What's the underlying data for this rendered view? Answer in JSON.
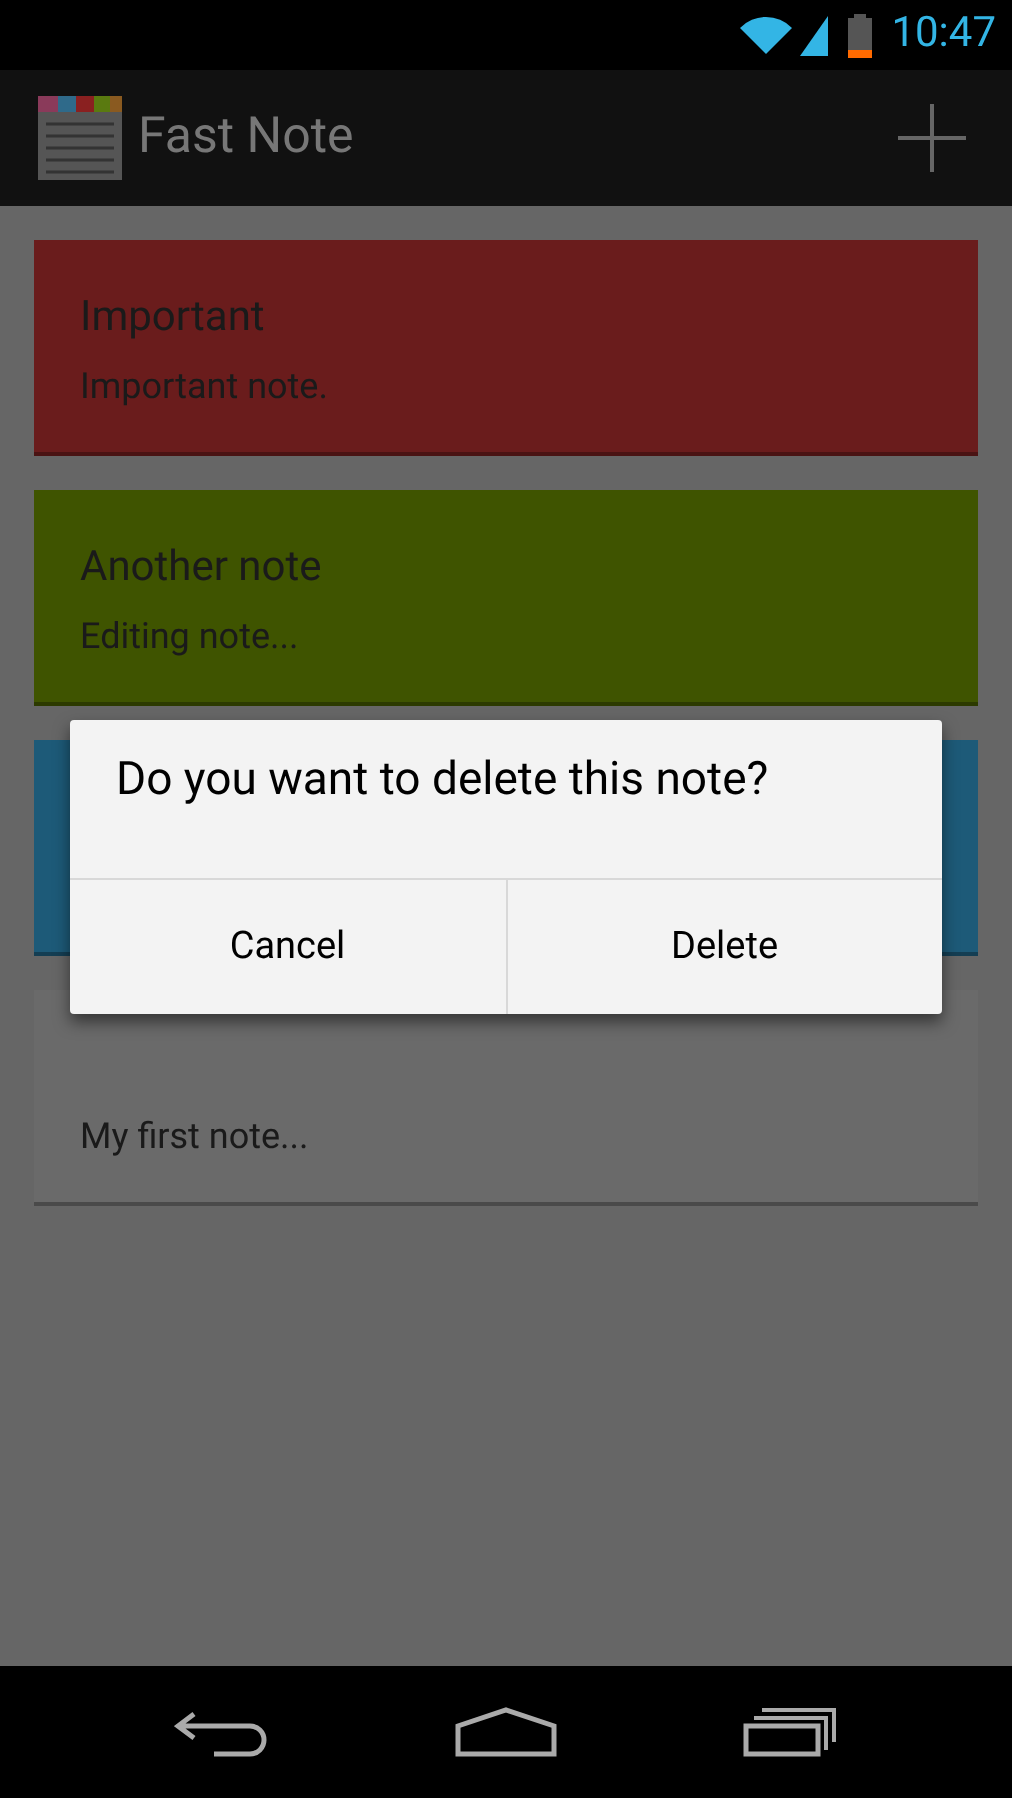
{
  "status_bar": {
    "time": "10:47"
  },
  "action_bar": {
    "title": "Fast Note"
  },
  "notes": [
    {
      "title": "Important",
      "body": "Important note.",
      "color": "#6a1c1c"
    },
    {
      "title": "Another note",
      "body": "Editing note...",
      "color": "#3f5400"
    },
    {
      "color": "#1d5a78"
    },
    {
      "body": "My first note...",
      "color": "#6a6a6a"
    }
  ],
  "dialog": {
    "message": "Do you want to delete this note?",
    "buttons": [
      "Cancel",
      "Delete"
    ]
  }
}
